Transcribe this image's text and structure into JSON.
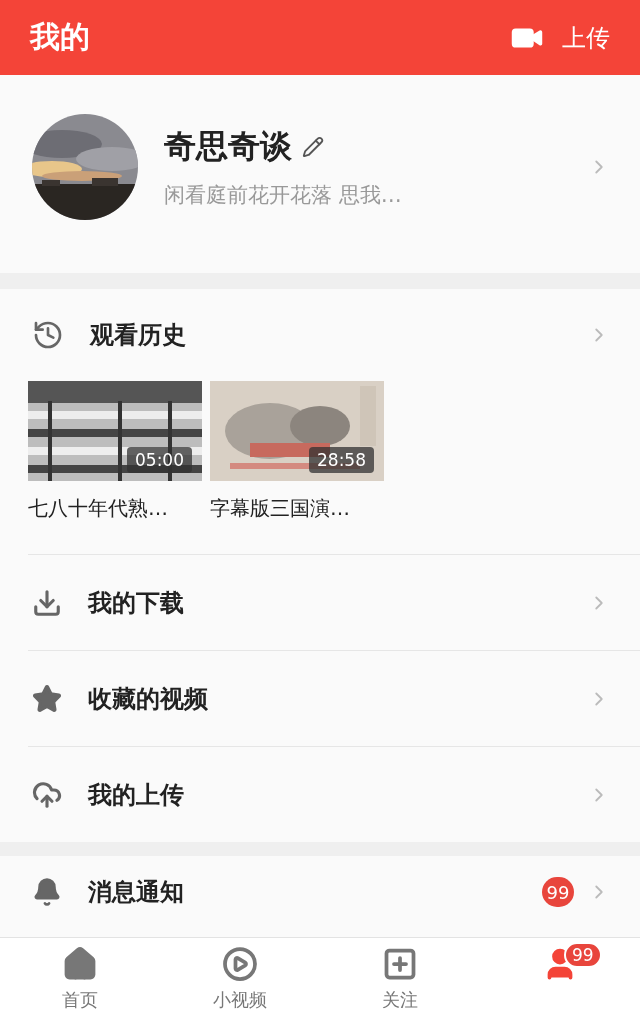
{
  "header": {
    "title": "我的",
    "upload_label": "上传"
  },
  "profile": {
    "name": "奇思奇谈",
    "bio": "闲看庭前花开花落 思我…"
  },
  "history": {
    "title": "观看历史",
    "videos": [
      {
        "title": "七八十年代熟…",
        "duration": "05:00"
      },
      {
        "title": "字幕版三国演…",
        "duration": "28:58"
      }
    ]
  },
  "menu": [
    {
      "label": "我的下载"
    },
    {
      "label": "收藏的视频"
    },
    {
      "label": "我的上传"
    }
  ],
  "notifications": {
    "label": "消息通知",
    "badge": "99"
  },
  "tabs": [
    {
      "label": "首页",
      "selected": false
    },
    {
      "label": "小视频",
      "selected": false
    },
    {
      "label": "关注",
      "selected": false
    },
    {
      "badge": "99",
      "selected": true
    }
  ]
}
